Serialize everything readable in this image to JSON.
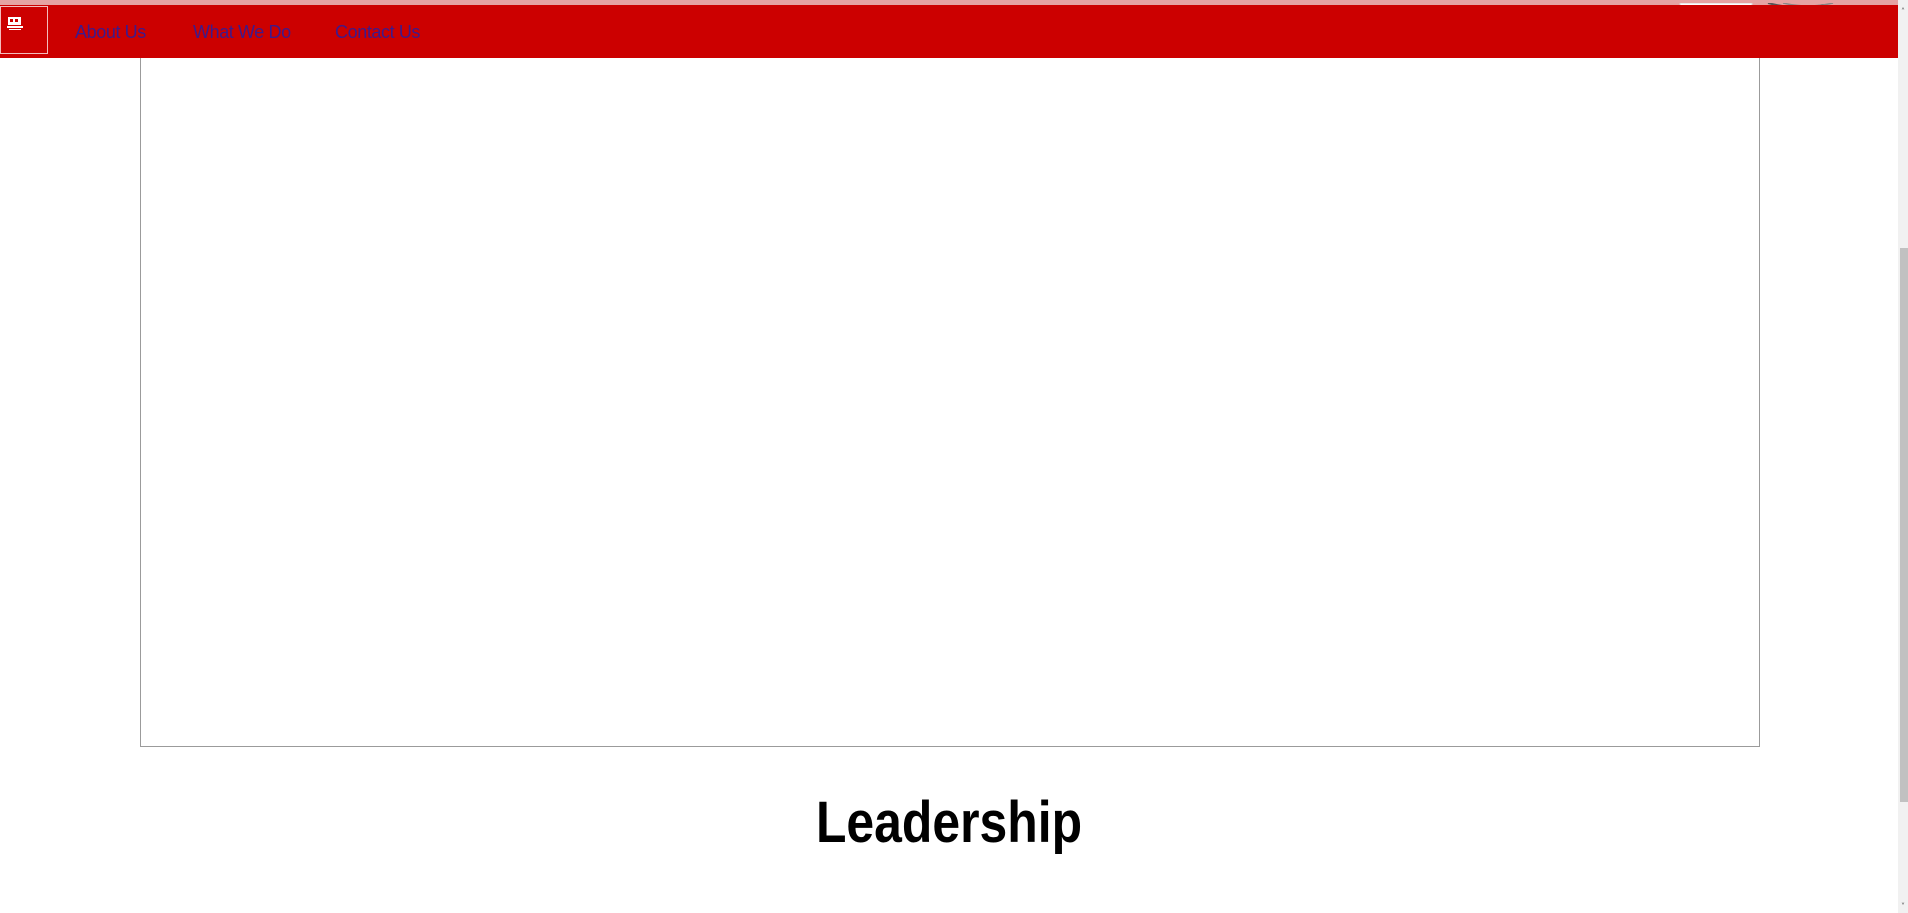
{
  "nav": {
    "logo_icon": "house-logo-icon",
    "links": [
      {
        "label": "About Us"
      },
      {
        "label": "What We Do"
      },
      {
        "label": "Contact Us"
      }
    ]
  },
  "main": {
    "heading": "Leadership"
  },
  "scrollbar": {
    "up_arrow": "˄",
    "down_arrow": "˅"
  },
  "colors": {
    "navbar": "#cc0000",
    "nav_link": "#3d1a8c",
    "heading": "#000000"
  }
}
